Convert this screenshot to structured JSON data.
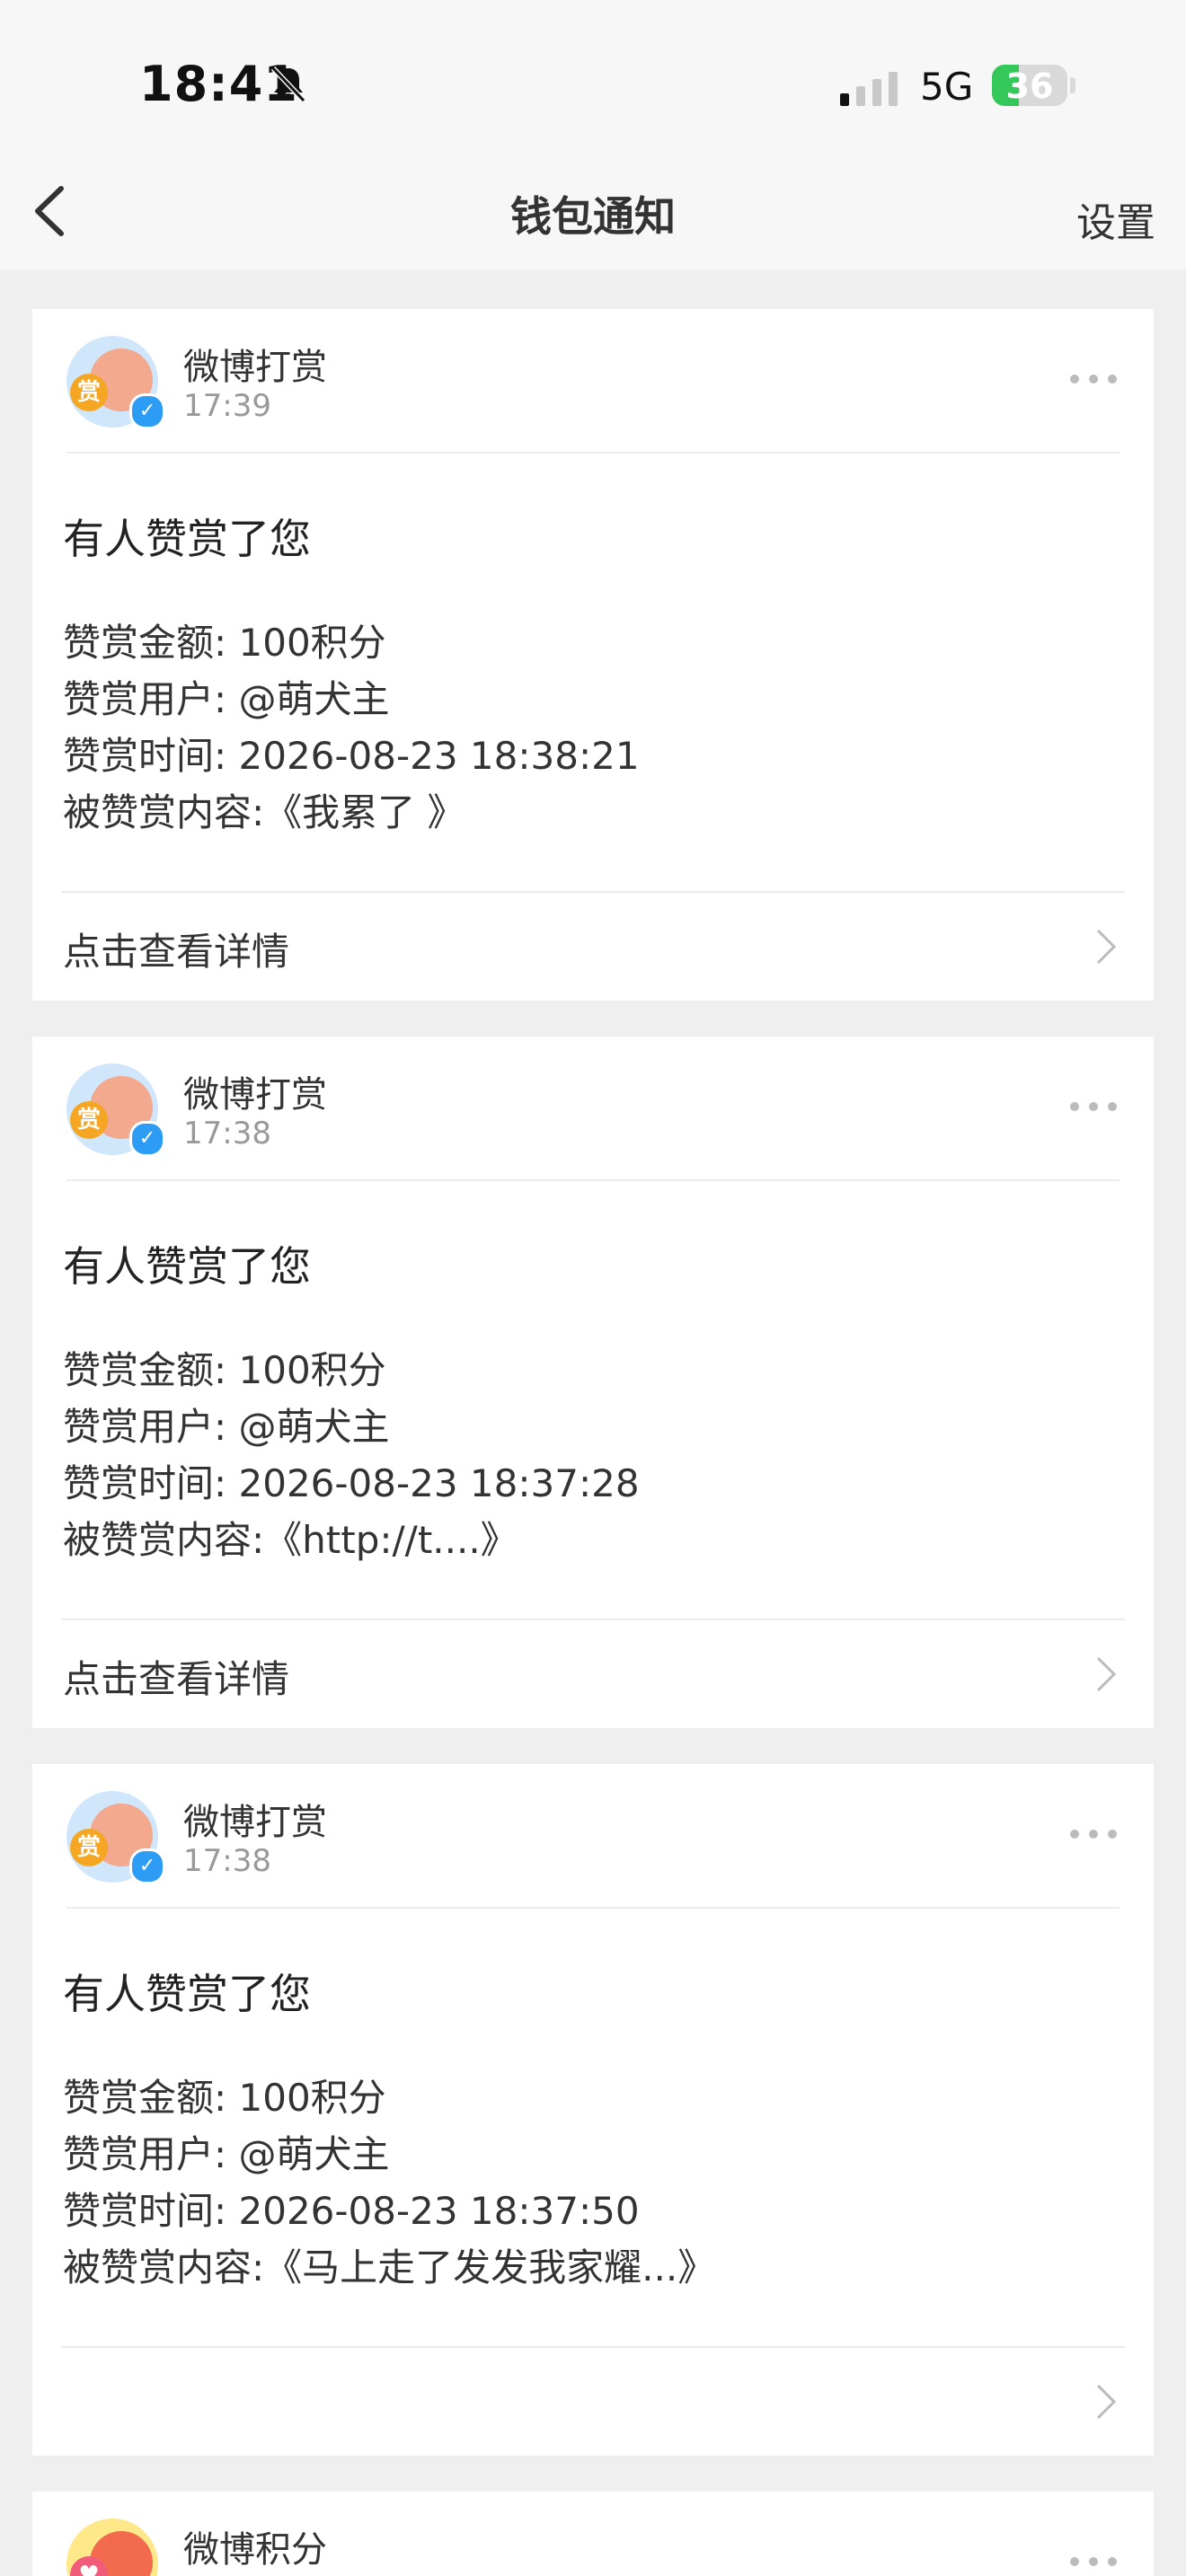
{
  "status_bar": {
    "time": "18:41",
    "network": "5G",
    "battery": "36",
    "battery_level": 0.36
  },
  "nav": {
    "title": "钱包通知",
    "settings_label": "设置"
  },
  "cards": [
    {
      "sender": "微博打赏",
      "time": "17:39",
      "headline": "有人赞赏了您",
      "amount": "赞赏金额: 100积分",
      "user": "赞赏用户: @萌犬主",
      "datetime": "赞赏时间: 2026-08-23 18:38:21",
      "content": "被赞赏内容:《我累了 》",
      "link": "点击查看详情"
    },
    {
      "sender": "微博打赏",
      "time": "17:38",
      "headline": "有人赞赏了您",
      "amount": "赞赏金额: 100积分",
      "user": "赞赏用户: @萌犬主",
      "datetime": "赞赏时间: 2026-08-23 18:37:28",
      "content": "被赞赏内容:《http://t....》",
      "link": "点击查看详情"
    },
    {
      "sender": "微博打赏",
      "time": "17:38",
      "headline": "有人赞赏了您",
      "amount": "赞赏金额: 100积分",
      "user": "赞赏用户: @萌犬主",
      "datetime": "赞赏时间: 2026-08-23 18:37:50",
      "content": "被赞赏内容:《马上走了发发我家耀...》",
      "link": ""
    },
    {
      "sender": "微博积分"
    }
  ],
  "icons": {
    "avatar_badge": "赏",
    "verified": "✓",
    "back": "chevron-left-icon",
    "more": "more-dots-icon",
    "row_arrow": "chevron-right-icon"
  },
  "colors": {
    "verified_blue": "#2d9cf4",
    "battery_green": "#34c759",
    "page_bg": "#efefef"
  }
}
